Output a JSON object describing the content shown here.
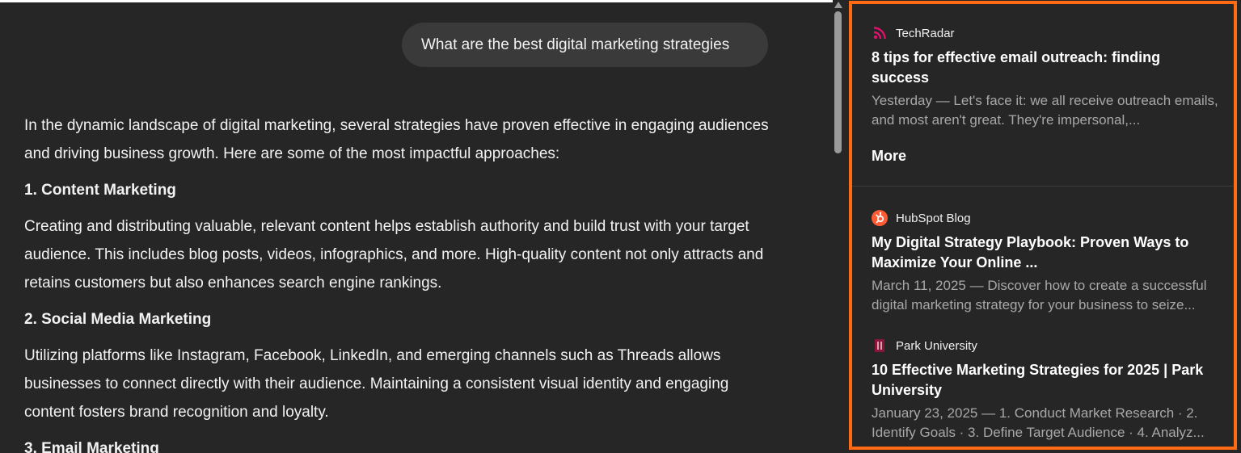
{
  "chat": {
    "user_query": "What are the best digital marketing strategies",
    "answer": {
      "intro": "In the dynamic landscape of digital marketing, several strategies have proven effective in engaging audiences and driving business growth. Here are some of the most impactful approaches:",
      "sections": [
        {
          "heading": "1. Content Marketing",
          "body": "Creating and distributing valuable, relevant content helps establish authority and build trust with your target audience. This includes blog posts, videos, infographics, and more. High-quality content not only attracts and retains customers but also enhances search engine rankings."
        },
        {
          "heading": "2. Social Media Marketing",
          "body": "Utilizing platforms like Instagram, Facebook, LinkedIn, and emerging channels such as Threads allows businesses to connect directly with their audience. Maintaining a consistent visual identity and engaging content fosters brand recognition and loyalty."
        },
        {
          "heading": "3. Email Marketing",
          "body": ""
        }
      ]
    }
  },
  "sources_panel": {
    "accent_color": "#ff6a13",
    "more_label": "More",
    "cards": [
      {
        "source": "TechRadar",
        "icon": "rss-icon",
        "icon_color": "#e0106c",
        "title": "8 tips for effective email outreach: finding success",
        "snippet": "Yesterday — Let's face it: we all receive outreach emails, and most aren't great. They're impersonal,..."
      },
      {
        "source": "HubSpot Blog",
        "icon": "hubspot-icon",
        "icon_color": "#ff5c35",
        "title": "My Digital Strategy Playbook: Proven Ways to Maximize Your Online ...",
        "snippet": "March 11, 2025 — Discover how to create a successful digital marketing strategy for your business to seize..."
      },
      {
        "source": "Park University",
        "icon": "park-university-icon",
        "icon_color": "#8a1538",
        "title": "10 Effective Marketing Strategies for 2025 | Park University",
        "snippet": "January 23, 2025 — 1. Conduct Market Research · 2. Identify Goals · 3. Define Target Audience · 4. Analyz..."
      }
    ]
  }
}
